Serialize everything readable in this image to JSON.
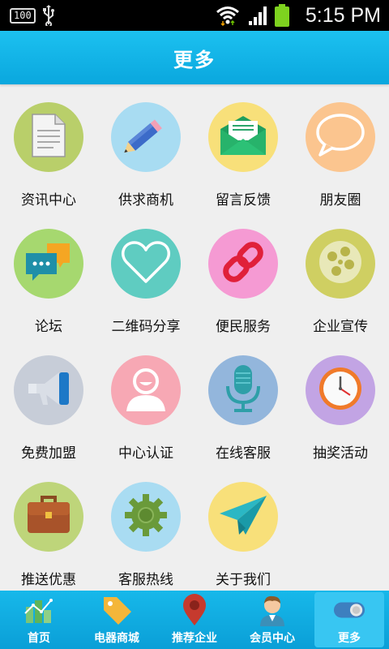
{
  "status_bar": {
    "battery_percent": "100",
    "time": "5:15 PM"
  },
  "header": {
    "title": "更多"
  },
  "grid": {
    "items": [
      {
        "label": "资讯中心",
        "icon": "document-icon",
        "color": "#b9cf6a"
      },
      {
        "label": "供求商机",
        "icon": "pencil-icon",
        "color": "#a8dcf2"
      },
      {
        "label": "留言反馈",
        "icon": "envelope-icon",
        "color": "#f8e07a"
      },
      {
        "label": "朋友圈",
        "icon": "speech-bubble-icon",
        "color": "#fbc58f"
      },
      {
        "label": "论坛",
        "icon": "chat-bubbles-icon",
        "color": "#a6d86f"
      },
      {
        "label": "二维码分享",
        "icon": "heart-icon",
        "color": "#5fccc1"
      },
      {
        "label": "便民服务",
        "icon": "link-icon",
        "color": "#f59ad3"
      },
      {
        "label": "企业宣传",
        "icon": "film-reel-icon",
        "color": "#cfcf62"
      },
      {
        "label": "免费加盟",
        "icon": "megaphone-icon",
        "color": "#c7cdd8"
      },
      {
        "label": "中心认证",
        "icon": "user-icon",
        "color": "#f7a8b4"
      },
      {
        "label": "在线客服",
        "icon": "microphone-icon",
        "color": "#93b6dc"
      },
      {
        "label": "抽奖活动",
        "icon": "clock-icon",
        "color": "#c2a4e4"
      },
      {
        "label": "推送优惠",
        "icon": "briefcase-icon",
        "color": "#bed57a"
      },
      {
        "label": "客服热线",
        "icon": "gear-icon",
        "color": "#a9dcf2"
      },
      {
        "label": "关于我们",
        "icon": "paper-plane-icon",
        "color": "#f8e07a"
      }
    ]
  },
  "tabbar": {
    "tabs": [
      {
        "label": "首页",
        "icon": "home-chart-icon"
      },
      {
        "label": "电器商城",
        "icon": "price-tag-icon"
      },
      {
        "label": "推荐企业",
        "icon": "map-pin-icon"
      },
      {
        "label": "会员中心",
        "icon": "member-icon"
      },
      {
        "label": "更多",
        "icon": "toggle-icon",
        "active": true
      }
    ]
  }
}
